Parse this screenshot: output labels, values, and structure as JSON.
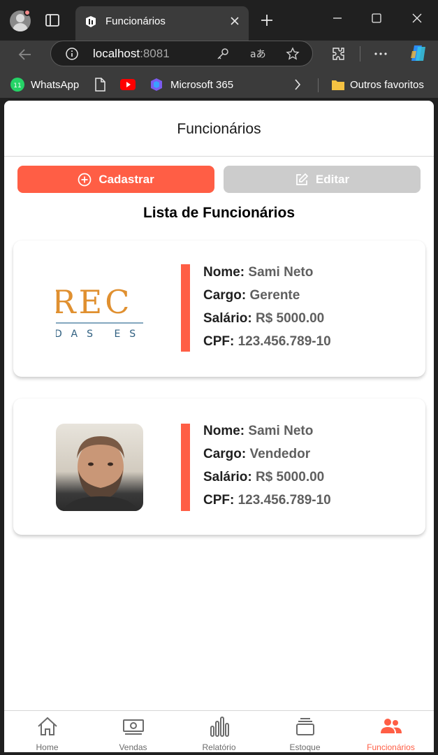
{
  "browser": {
    "tab_title": "Funcionários",
    "url_host": "localhost",
    "url_port": ":8081",
    "favorites": [
      {
        "label": "WhatsApp",
        "icon": "whatsapp-icon"
      },
      {
        "label": "",
        "icon": "document-icon"
      },
      {
        "label": "",
        "icon": "youtube-icon"
      },
      {
        "label": "Microsoft 365",
        "icon": "microsoft-365-icon"
      }
    ],
    "other_favorites": "Outros favoritos",
    "whatsapp_badge": "11"
  },
  "header": {
    "title": "Funcionários"
  },
  "actions": {
    "register_label": "Cadastrar",
    "edit_label": "Editar"
  },
  "list": {
    "title": "Lista de Funcionários",
    "labels": {
      "name": "Nome:",
      "role": "Cargo:",
      "salary": "Salário:",
      "cpf": "CPF:"
    },
    "employees": [
      {
        "name": "Sami Neto",
        "role": "Gerente",
        "salary": "R$ 5000.00",
        "cpf": "123.456.789-10",
        "image": "company-logo",
        "logo_text_top": "REC",
        "logo_text_bottom": "DAS ES"
      },
      {
        "name": "Sami Neto",
        "role": "Vendedor",
        "salary": "R$ 5000.00",
        "cpf": "123.456.789-10",
        "image": "profile-photo"
      }
    ]
  },
  "bottom_nav": [
    {
      "label": "Home",
      "icon": "home-icon",
      "active": false
    },
    {
      "label": "Vendas",
      "icon": "money-icon",
      "active": false
    },
    {
      "label": "Relatório",
      "icon": "bar-chart-icon",
      "active": false
    },
    {
      "label": "Estoque",
      "icon": "stack-icon",
      "active": false
    },
    {
      "label": "Funcionários",
      "icon": "people-icon",
      "active": true
    }
  ],
  "colors": {
    "accent": "#ff5e45",
    "disabled": "#cccccc"
  }
}
